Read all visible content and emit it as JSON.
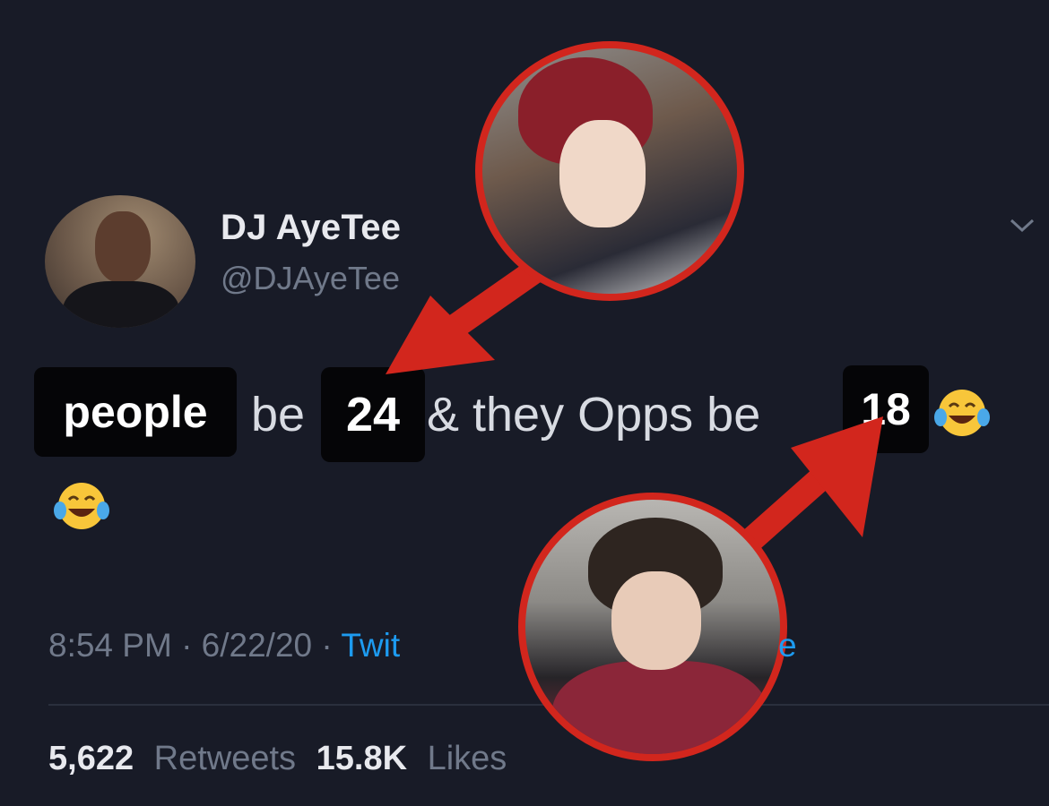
{
  "author": {
    "display_name": "DJ AyeTee",
    "handle": "@DJAyeTee"
  },
  "tweet": {
    "word_be_1": "be",
    "text_rest": "& they Opps be",
    "emoji_name": "face-with-tears-of-joy"
  },
  "labels": {
    "people": "people",
    "num_24": "24",
    "num_18": "18"
  },
  "meta": {
    "timestamp": "8:54 PM · 6/22/20 · ",
    "source_prefix": "Twit",
    "source_suffix": "e"
  },
  "stats": {
    "retweets_count": "5,622",
    "retweets_label": "Retweets",
    "likes_count": "15.8K",
    "likes_label": "Likes"
  },
  "colors": {
    "background": "#181b27",
    "accent_red": "#d2261d",
    "link_blue": "#1d9bf0"
  },
  "icons": [
    "chevron-down-icon",
    "laughing-emoji-icon",
    "arrow-icon"
  ]
}
